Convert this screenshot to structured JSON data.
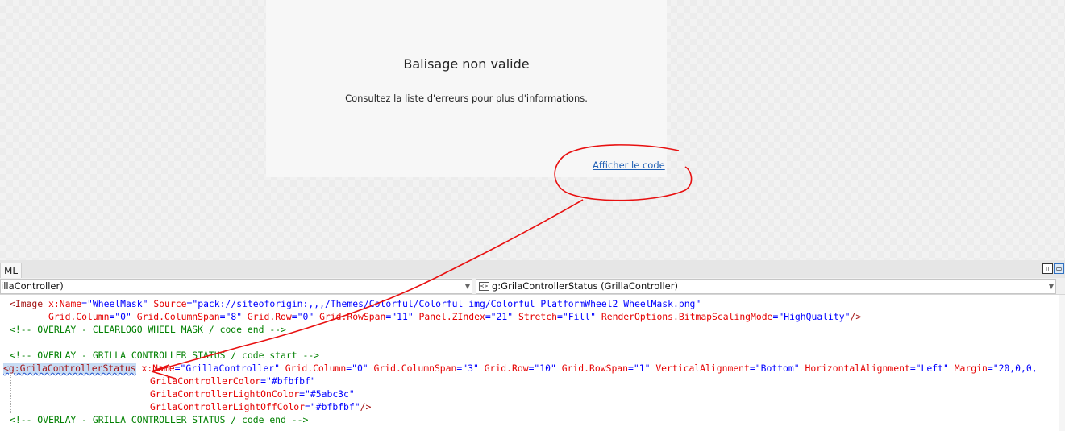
{
  "designer": {
    "title": "Balisage non valide",
    "subtitle": "Consultez la liste d'erreurs pour plus d'informations.",
    "link": "Afficher le code"
  },
  "tabs": {
    "xaml_tab": "ML"
  },
  "nav": {
    "left_combo": "illaController)",
    "right_combo": "g:GrilaControllerStatus (GrillaController)",
    "right_combo_icon": "tag-icon"
  },
  "code": {
    "l1_p1": "<Image ",
    "l1_a1": "x:Name",
    "l1_eq1": "=\"",
    "l1_v1": "WheelMask",
    "l1_q1": "\" ",
    "l1_a2": "Source",
    "l1_eq2": "=\"",
    "l1_v2": "pack://siteoforigin:,,,/Themes/Colorful/Colorful_img/Colorful_PlatformWheel2_WheelMask.png",
    "l1_q2": "\"",
    "l2_a1": "Grid.Column",
    "l2_v1": "0",
    "l2_a2": "Grid.ColumnSpan",
    "l2_v2": "8",
    "l2_a3": "Grid.Row",
    "l2_v3": "0",
    "l2_a4": "Grid.RowSpan",
    "l2_v4": "11",
    "l2_a5": "Panel.ZIndex",
    "l2_v5": "21",
    "l2_a6": "Stretch",
    "l2_v6": "Fill",
    "l2_a7": "RenderOptions.BitmapScalingMode",
    "l2_v7": "HighQuality",
    "l3": "<!-- OVERLAY - CLEARLOGO WHEEL MASK / code end -->",
    "l5": "<!-- OVERLAY - GRILLA CONTROLLER STATUS / code start -->",
    "l6_tag": "<g:GrilaControllerStatus",
    "l6_a1": "x:Name",
    "l6_v1": "GrillaController",
    "l6_a2": "Grid.Column",
    "l6_v2": "0",
    "l6_a3": "Grid.ColumnSpan",
    "l6_v3": "3",
    "l6_a4": "Grid.Row",
    "l6_v4": "10",
    "l6_a5": "Grid.RowSpan",
    "l6_v5": "1",
    "l6_a6": "VerticalAlignment",
    "l6_v6": "Bottom",
    "l6_a7": "HorizontalAlignment",
    "l6_v7": "Left",
    "l6_a8": "Margin",
    "l6_v8": "20,0,0,",
    "l7_a": "GrilaControllerColor",
    "l7_v": "#bfbfbf",
    "l8_a": "GrilaControllerLightOnColor",
    "l8_v": "#5abc3c",
    "l9_a": "GrilaControllerLightOffColor",
    "l9_v": "#bfbfbf",
    "l10": "<!-- OVERLAY - GRILLA CONTROLLER STATUS / code end -->"
  },
  "colors": {
    "annotation": "#e81010",
    "tag": "#a31515",
    "attribute": "#e50000",
    "value": "#0000ff",
    "comment": "#008000",
    "link": "#1f5fb4"
  }
}
